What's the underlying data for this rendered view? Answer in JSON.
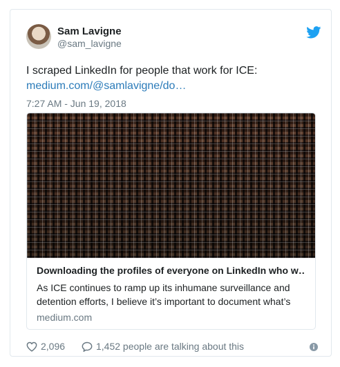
{
  "author": {
    "display_name": "Sam Lavigne",
    "screen_name": "@sam_lavigne"
  },
  "tweet": {
    "text": "I scraped LinkedIn for people that work for ICE:",
    "link": "medium.com/@samlavigne/do…",
    "timestamp": "7:27 AM - Jun 19, 2018"
  },
  "card": {
    "title": "Downloading the profiles of everyone on LinkedIn who w…",
    "description": "As ICE continues to ramp up its inhumane surveillance and detention efforts, I believe it’s important to document what’s",
    "domain": "medium.com"
  },
  "actions": {
    "likes": "2,096",
    "replies": "1,452 people are talking about this"
  },
  "colors": {
    "twitter_blue": "#1da1f2",
    "link_blue": "#2b7bb9",
    "muted_text": "#697882",
    "border": "#e1e8ed"
  },
  "icons": [
    "twitter-bird-icon",
    "heart-icon",
    "comment-bubble-icon",
    "info-icon"
  ]
}
